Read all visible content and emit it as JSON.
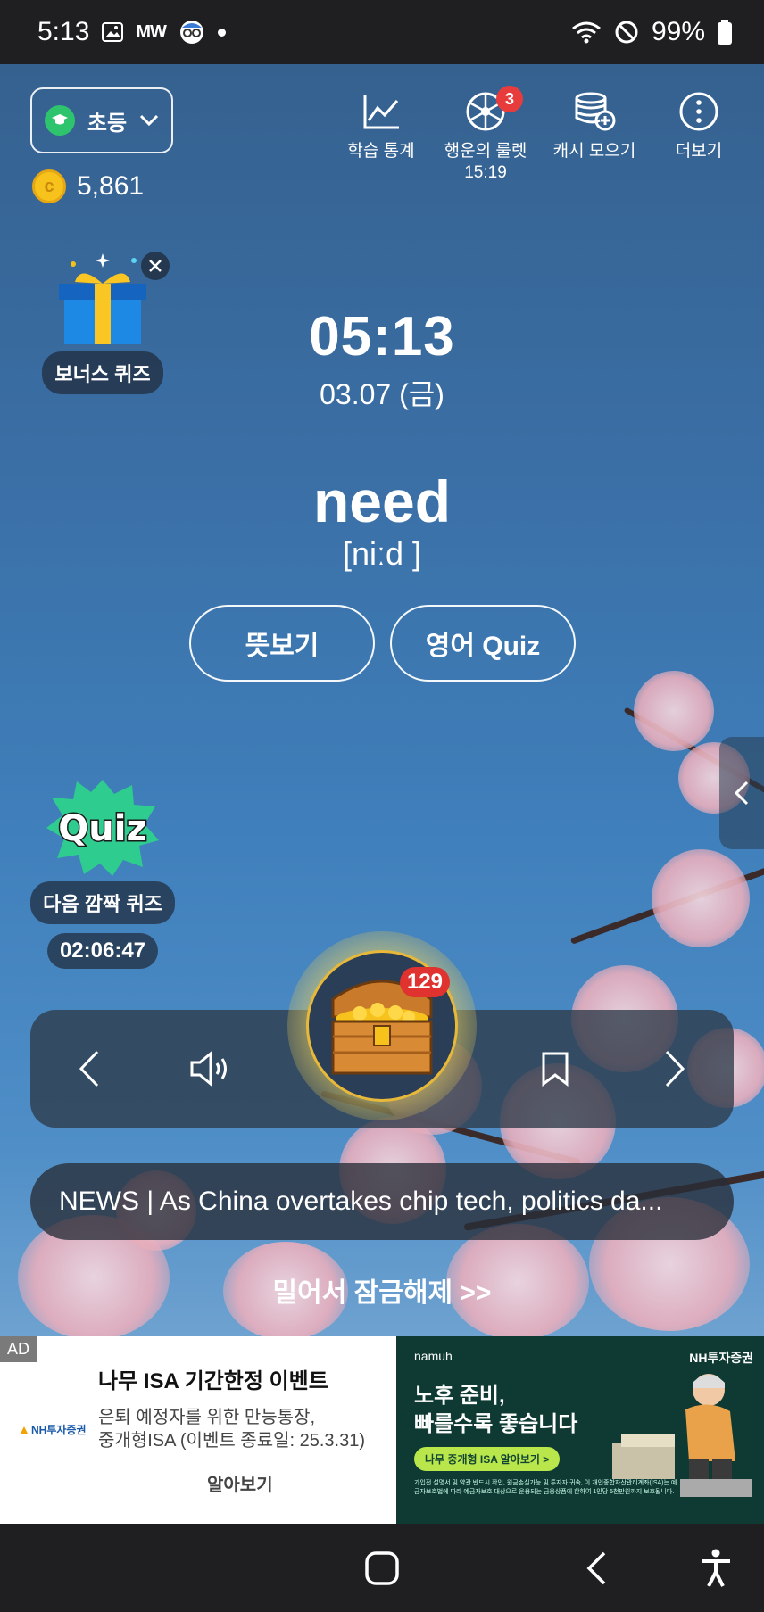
{
  "status_bar": {
    "time": "5:13",
    "app_indicator": "MW",
    "battery": "99%",
    "icons": [
      "gallery-icon",
      "app-icon",
      "notification-dot",
      "wifi-icon",
      "dnd-icon",
      "battery-icon"
    ]
  },
  "header": {
    "grade": "초등",
    "coins": "5,861",
    "nav": [
      {
        "label": "학습 통계",
        "sub": "",
        "icon": "chart-icon"
      },
      {
        "label": "행운의 룰렛",
        "sub": "15:19",
        "icon": "roulette-icon",
        "badge": "3"
      },
      {
        "label": "캐시 모으기",
        "sub": "",
        "icon": "coin-stack-icon"
      },
      {
        "label": "더보기",
        "sub": "",
        "icon": "more-icon"
      }
    ]
  },
  "bonus_quiz": {
    "label": "보너스 퀴즈"
  },
  "clock": {
    "time": "05:13",
    "date": "03.07 (금)"
  },
  "word": {
    "text": "need",
    "phonetic": "[niːd ]"
  },
  "actions": {
    "meaning": "뜻보기",
    "quiz": "영어 Quiz"
  },
  "surprise_quiz": {
    "badge_text": "Quiz",
    "label": "다음 깜짝 퀴즈",
    "timer": "02:06:47"
  },
  "chest": {
    "count": "129"
  },
  "news": {
    "text": "NEWS | As China overtakes chip tech, politics da..."
  },
  "unlock": {
    "text": "밀어서 잠금해제 >>"
  },
  "ad": {
    "label": "AD",
    "logo": "NH투자증권",
    "title": "나무 ISA 기간한정 이벤트",
    "desc1": "은퇴 예정자를 위한 만능통장,",
    "desc2": "중개형ISA (이벤트 종료일: 25.3.31)",
    "more": "알아보기",
    "banner": {
      "brand": "namuh",
      "brand2": "NH투자증권",
      "headline1": "노후 준비,",
      "headline2": "빠를수록 좋습니다",
      "cta": "나무 중개형 ISA 알아보기 >",
      "fine": "가입전 설명서 및 약관 반드시 확인, 원금손실가능 및 투자자 귀속, 이 개인종합자산관리계좌(ISA)는 예금자보호법에 따라 예금자보호 대상으로 운용되는 금융상품에 한하여 1인당 5천만원까지 보호됩니다."
    }
  },
  "colors": {
    "accent": "#2ec46d",
    "badge": "#e83c3c",
    "coin": "#f6c21b"
  }
}
